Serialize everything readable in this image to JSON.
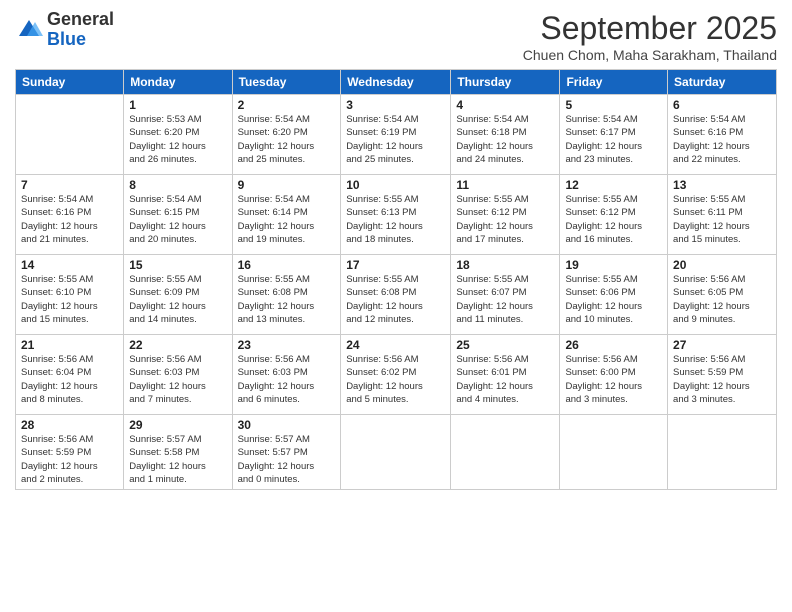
{
  "logo": {
    "general": "General",
    "blue": "Blue"
  },
  "header": {
    "month": "September 2025",
    "location": "Chuen Chom, Maha Sarakham, Thailand"
  },
  "weekdays": [
    "Sunday",
    "Monday",
    "Tuesday",
    "Wednesday",
    "Thursday",
    "Friday",
    "Saturday"
  ],
  "weeks": [
    [
      {
        "day": "",
        "info": ""
      },
      {
        "day": "1",
        "info": "Sunrise: 5:53 AM\nSunset: 6:20 PM\nDaylight: 12 hours\nand 26 minutes."
      },
      {
        "day": "2",
        "info": "Sunrise: 5:54 AM\nSunset: 6:20 PM\nDaylight: 12 hours\nand 25 minutes."
      },
      {
        "day": "3",
        "info": "Sunrise: 5:54 AM\nSunset: 6:19 PM\nDaylight: 12 hours\nand 25 minutes."
      },
      {
        "day": "4",
        "info": "Sunrise: 5:54 AM\nSunset: 6:18 PM\nDaylight: 12 hours\nand 24 minutes."
      },
      {
        "day": "5",
        "info": "Sunrise: 5:54 AM\nSunset: 6:17 PM\nDaylight: 12 hours\nand 23 minutes."
      },
      {
        "day": "6",
        "info": "Sunrise: 5:54 AM\nSunset: 6:16 PM\nDaylight: 12 hours\nand 22 minutes."
      }
    ],
    [
      {
        "day": "7",
        "info": "Sunrise: 5:54 AM\nSunset: 6:16 PM\nDaylight: 12 hours\nand 21 minutes."
      },
      {
        "day": "8",
        "info": "Sunrise: 5:54 AM\nSunset: 6:15 PM\nDaylight: 12 hours\nand 20 minutes."
      },
      {
        "day": "9",
        "info": "Sunrise: 5:54 AM\nSunset: 6:14 PM\nDaylight: 12 hours\nand 19 minutes."
      },
      {
        "day": "10",
        "info": "Sunrise: 5:55 AM\nSunset: 6:13 PM\nDaylight: 12 hours\nand 18 minutes."
      },
      {
        "day": "11",
        "info": "Sunrise: 5:55 AM\nSunset: 6:12 PM\nDaylight: 12 hours\nand 17 minutes."
      },
      {
        "day": "12",
        "info": "Sunrise: 5:55 AM\nSunset: 6:12 PM\nDaylight: 12 hours\nand 16 minutes."
      },
      {
        "day": "13",
        "info": "Sunrise: 5:55 AM\nSunset: 6:11 PM\nDaylight: 12 hours\nand 15 minutes."
      }
    ],
    [
      {
        "day": "14",
        "info": "Sunrise: 5:55 AM\nSunset: 6:10 PM\nDaylight: 12 hours\nand 15 minutes."
      },
      {
        "day": "15",
        "info": "Sunrise: 5:55 AM\nSunset: 6:09 PM\nDaylight: 12 hours\nand 14 minutes."
      },
      {
        "day": "16",
        "info": "Sunrise: 5:55 AM\nSunset: 6:08 PM\nDaylight: 12 hours\nand 13 minutes."
      },
      {
        "day": "17",
        "info": "Sunrise: 5:55 AM\nSunset: 6:08 PM\nDaylight: 12 hours\nand 12 minutes."
      },
      {
        "day": "18",
        "info": "Sunrise: 5:55 AM\nSunset: 6:07 PM\nDaylight: 12 hours\nand 11 minutes."
      },
      {
        "day": "19",
        "info": "Sunrise: 5:55 AM\nSunset: 6:06 PM\nDaylight: 12 hours\nand 10 minutes."
      },
      {
        "day": "20",
        "info": "Sunrise: 5:56 AM\nSunset: 6:05 PM\nDaylight: 12 hours\nand 9 minutes."
      }
    ],
    [
      {
        "day": "21",
        "info": "Sunrise: 5:56 AM\nSunset: 6:04 PM\nDaylight: 12 hours\nand 8 minutes."
      },
      {
        "day": "22",
        "info": "Sunrise: 5:56 AM\nSunset: 6:03 PM\nDaylight: 12 hours\nand 7 minutes."
      },
      {
        "day": "23",
        "info": "Sunrise: 5:56 AM\nSunset: 6:03 PM\nDaylight: 12 hours\nand 6 minutes."
      },
      {
        "day": "24",
        "info": "Sunrise: 5:56 AM\nSunset: 6:02 PM\nDaylight: 12 hours\nand 5 minutes."
      },
      {
        "day": "25",
        "info": "Sunrise: 5:56 AM\nSunset: 6:01 PM\nDaylight: 12 hours\nand 4 minutes."
      },
      {
        "day": "26",
        "info": "Sunrise: 5:56 AM\nSunset: 6:00 PM\nDaylight: 12 hours\nand 3 minutes."
      },
      {
        "day": "27",
        "info": "Sunrise: 5:56 AM\nSunset: 5:59 PM\nDaylight: 12 hours\nand 3 minutes."
      }
    ],
    [
      {
        "day": "28",
        "info": "Sunrise: 5:56 AM\nSunset: 5:59 PM\nDaylight: 12 hours\nand 2 minutes."
      },
      {
        "day": "29",
        "info": "Sunrise: 5:57 AM\nSunset: 5:58 PM\nDaylight: 12 hours\nand 1 minute."
      },
      {
        "day": "30",
        "info": "Sunrise: 5:57 AM\nSunset: 5:57 PM\nDaylight: 12 hours\nand 0 minutes."
      },
      {
        "day": "",
        "info": ""
      },
      {
        "day": "",
        "info": ""
      },
      {
        "day": "",
        "info": ""
      },
      {
        "day": "",
        "info": ""
      }
    ]
  ]
}
